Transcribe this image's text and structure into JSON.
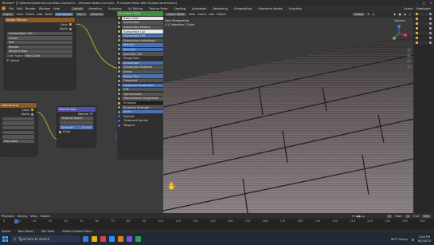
{
  "window": {
    "title": "Blender* [C:\\Blender\\Materials.com\\Max-Course\\11 - Ultimate Nodes Course\\2 - Principled Mode With Image\\Carrel.blend]",
    "controls": [
      "–",
      "□",
      "✕"
    ]
  },
  "menubar": {
    "items": [
      "File",
      "Edit",
      "Render",
      "Window",
      "Help"
    ],
    "workspaces": [
      "Layout",
      "Modeling",
      "Sculpting",
      "UV Editing",
      "Texture Paint",
      "Shading",
      "Animation",
      "Rendering",
      "Compositing",
      "Geometry Nodes",
      "Scripting"
    ],
    "active_workspace": "Layout",
    "scene": "Scene",
    "view_layer": "ViewLayer"
  },
  "node_editor": {
    "header": [
      "Object",
      "View",
      "Select",
      "Add",
      "Node",
      "Use Nodes",
      "Slot 1",
      "Material"
    ],
    "image_node": {
      "title": "Image Texture",
      "image_name": "tumbsofloor 1-8...",
      "outputs": [
        "Color",
        "Alpha"
      ],
      "fields": [
        "Linear",
        "Flat",
        "Repeat",
        "Single Image",
        "Non-Color"
      ],
      "color_space_label": "Color Space",
      "vector_label": "Vector"
    },
    "image_node_2": {
      "title": "Normal.png",
      "outputs": [
        "Color",
        "Alpha"
      ],
      "fields": [
        "Non-Color"
      ]
    },
    "normal_map": {
      "title": "Normal Map",
      "output": "Normal",
      "space": "Tangent Space",
      "strength_label": "Strength",
      "strength_value": "10.000",
      "color_label": "Color"
    },
    "bsdf": {
      "title": "Principled BSDF",
      "rows": [
        {
          "label": "Base Color",
          "style": "white"
        },
        {
          "label": "Subsurface",
          "style": "grey"
        },
        {
          "label": "Subsurface Radius",
          "style": "grey"
        },
        {
          "label": "Subsurface Col",
          "style": "white"
        },
        {
          "label": "Subsurface IOR",
          "style": "blue"
        },
        {
          "label": "Subsurface Anisotropy",
          "style": "grey"
        },
        {
          "label": "Metallic",
          "style": "blue"
        },
        {
          "label": "Specular",
          "style": "blue"
        },
        {
          "label": "Specular Tint",
          "style": "grey"
        },
        {
          "label": "Roughness",
          "style": "none"
        },
        {
          "label": "Anisotropic",
          "style": "blue"
        },
        {
          "label": "Anisotropic Rotation",
          "style": "grey"
        },
        {
          "label": "Sheen",
          "style": "grey"
        },
        {
          "label": "Sheen Tint",
          "style": "blue"
        },
        {
          "label": "Clearcoat",
          "style": "grey"
        },
        {
          "label": "Clearcoat Roughness",
          "style": "blue"
        },
        {
          "label": "IOR",
          "style": "grey"
        },
        {
          "label": "Transmission",
          "style": "grey"
        },
        {
          "label": "Transmission Roughness",
          "style": "grey"
        },
        {
          "label": "Emission",
          "style": "dark"
        },
        {
          "label": "Emission Strength",
          "style": "grey"
        },
        {
          "label": "Alpha",
          "style": "blue"
        },
        {
          "label": "Normal",
          "style": "none"
        },
        {
          "label": "Clearcoat Normal",
          "style": "none"
        },
        {
          "label": "Tangent",
          "style": "none"
        }
      ]
    }
  },
  "viewport": {
    "header": [
      "Object Mode",
      "View",
      "Select",
      "Add",
      "Object"
    ],
    "transform": "Global",
    "info_line1": "User Perspective",
    "info_line2": "(1) Collection | Cube",
    "options_label": "Options"
  },
  "outliner": {
    "rows": 7
  },
  "timeline": {
    "header": [
      "Playback",
      "Keying",
      "View",
      "Marker"
    ],
    "start_label": "Start",
    "start_value": "1",
    "end_label": "End",
    "end_value": "250",
    "current_frame": "1",
    "ticks": [
      "0",
      "10",
      "20",
      "30",
      "40",
      "50",
      "60",
      "70",
      "80",
      "90",
      "100",
      "110",
      "120",
      "130",
      "140",
      "150",
      "160",
      "170",
      "180",
      "190",
      "200",
      "210",
      "220",
      "230",
      "240",
      "250"
    ]
  },
  "statusbar": {
    "items": [
      "Select",
      "Box Select",
      "Pan View",
      "Select Context Menu"
    ]
  },
  "taskbar": {
    "search_placeholder": "Type here to search",
    "weather": "80°F Sunny",
    "time": "5:26 PM",
    "date": "6/2/2023"
  }
}
